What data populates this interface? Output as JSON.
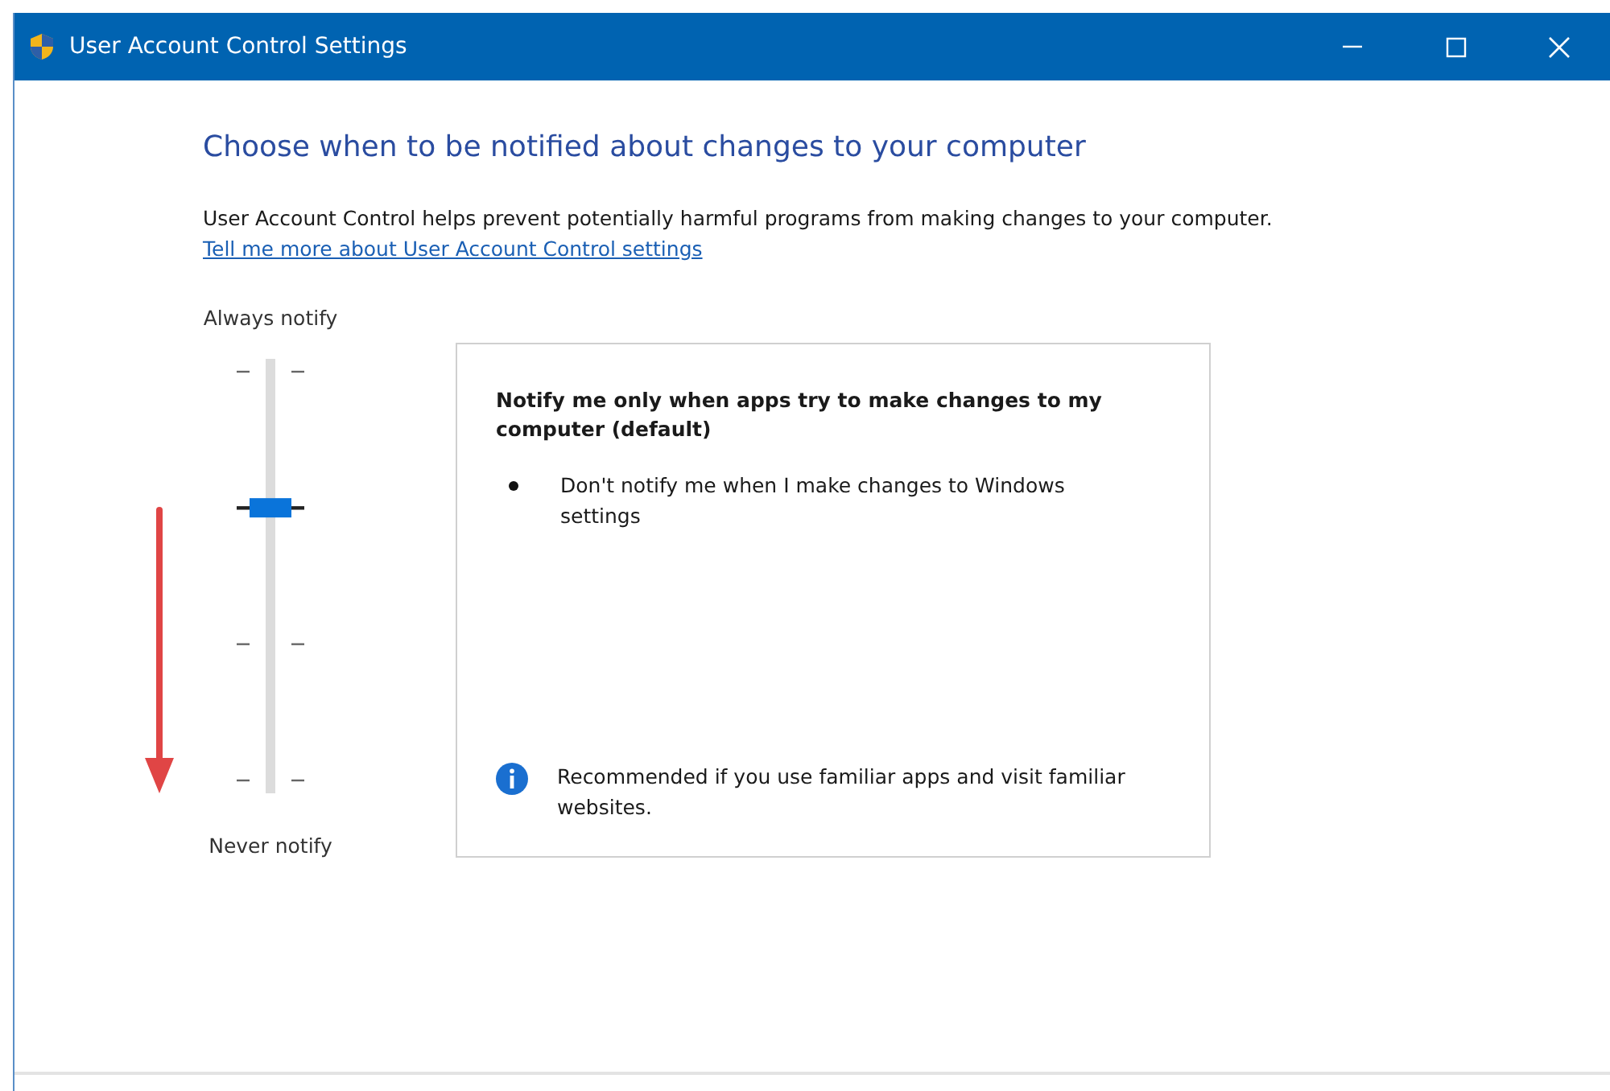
{
  "window": {
    "title": "User Account Control Settings"
  },
  "heading": "Choose when to be notified about changes to your computer",
  "description": "User Account Control helps prevent potentially harmful programs from making changes to your computer.",
  "link": "Tell me more about User Account Control settings",
  "slider": {
    "top_label": "Always notify",
    "bottom_label": "Never notify",
    "level": 0.667
  },
  "details": {
    "title": "Notify me only when apps try to make changes to my computer (default)",
    "bullets": [
      "Don't notify me when I make changes to Windows settings"
    ],
    "note": "Recommended if you use familiar apps and visit familiar websites."
  }
}
